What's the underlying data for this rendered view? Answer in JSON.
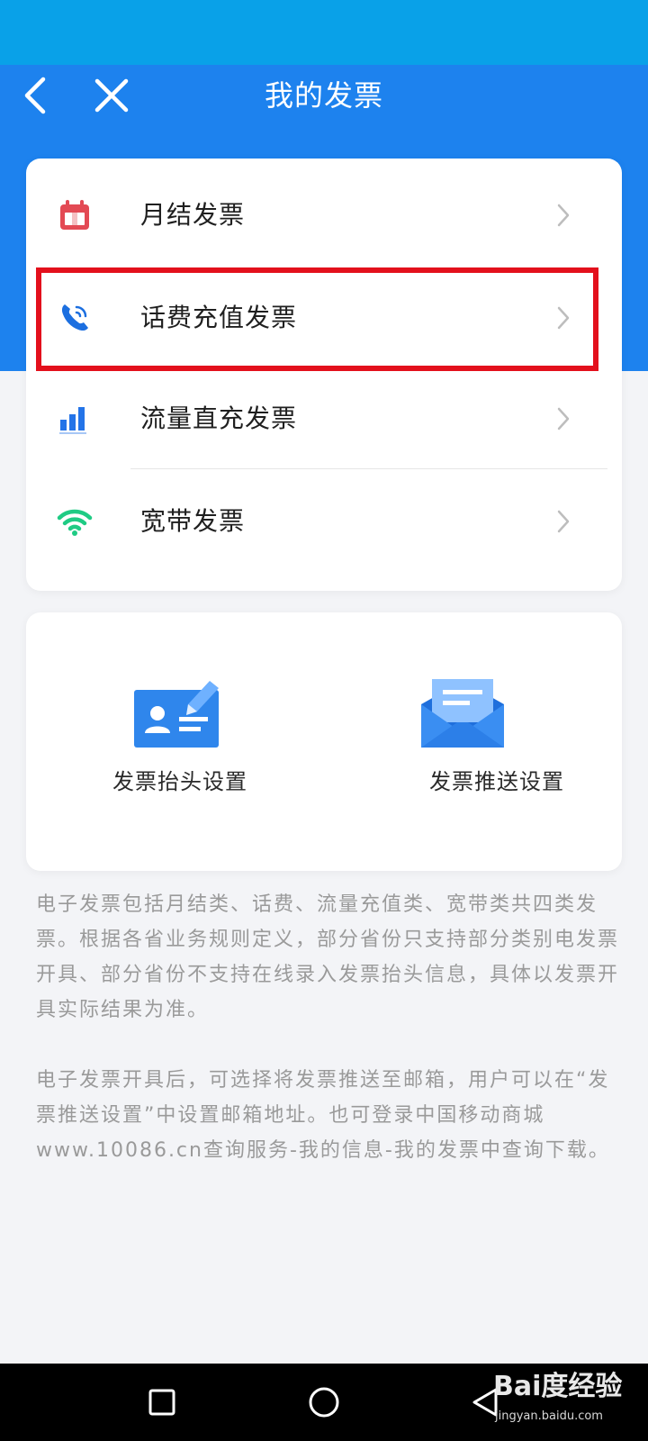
{
  "header": {
    "title": "我的发票"
  },
  "invoice_types": [
    {
      "label": "月结发票",
      "icon": "calendar-icon"
    },
    {
      "label": "话费充值发票",
      "icon": "phone-icon"
    },
    {
      "label": "流量直充发票",
      "icon": "bar-chart-icon"
    },
    {
      "label": "宽带发票",
      "icon": "wifi-icon"
    }
  ],
  "settings": [
    {
      "label": "发票抬头设置",
      "icon": "id-card-icon"
    },
    {
      "label": "发票推送设置",
      "icon": "envelope-icon"
    }
  ],
  "notes": [
    "电子发票包括月结类、话费、流量充值类、宽带类共四类发票。根据各省业务规则定义，部分省份只支持部分类别电发票开具、部分省份不支持在线录入发票抬头信息，具体以发票开具实际结果为准。",
    "电子发票开具后，可选择将发票推送至邮箱，用户可以在“发票推送设置”中设置邮箱地址。也可登录中国移动商城www.10086.cn查询服务-我的信息-我的发票中查询下载。"
  ],
  "watermark": {
    "line1": "Bai度经验",
    "line2": "jingyan.baidu.com"
  },
  "colors": {
    "header_blue": "#1d82ee",
    "status_blue": "#09a1e8",
    "highlight_red": "#e3101c",
    "calendar_red": "#e34a54",
    "phone_blue": "#1c6fe0",
    "chart_blue": "#2474e8",
    "wifi_green": "#1fcb84"
  }
}
